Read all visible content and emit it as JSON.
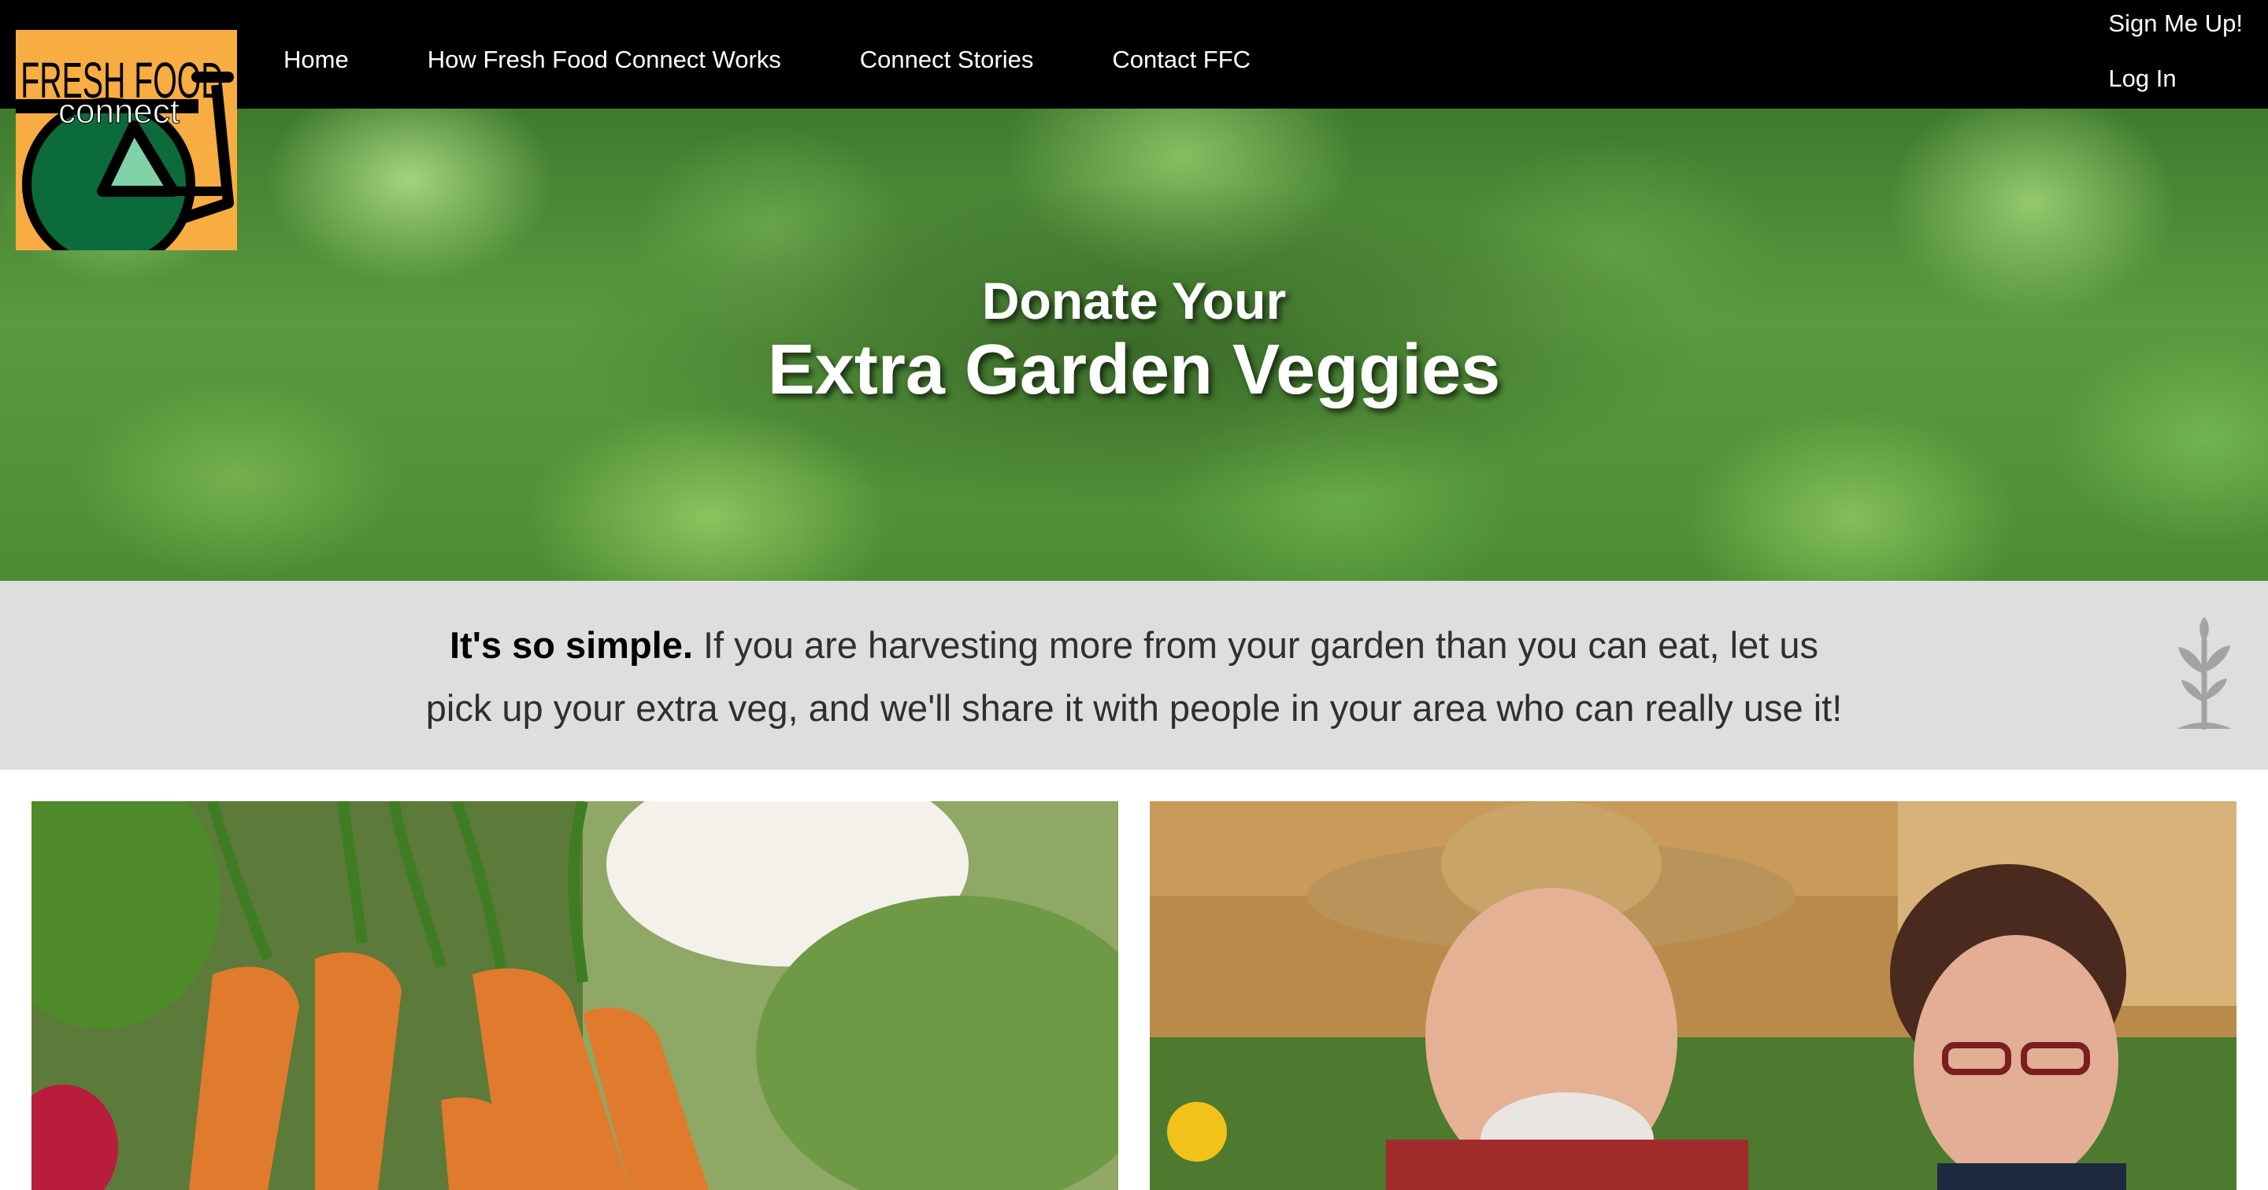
{
  "header": {
    "logo": {
      "line1": "FRESH FOOD",
      "line2": "connect",
      "colors": {
        "background": "#f7ad42",
        "wheel": "#0c6b3b",
        "wheel_inner": "#7fd3a6",
        "frame": "#000000"
      }
    },
    "nav": [
      {
        "label": "Home"
      },
      {
        "label": "How Fresh Food Connect Works"
      },
      {
        "label": "Connect Stories"
      },
      {
        "label": "Contact FFC"
      }
    ],
    "account": {
      "signup_label": "Sign Me Up!",
      "login_label": "Log In"
    },
    "colors": {
      "bar": "#000000",
      "text": "#ffffff"
    }
  },
  "hero": {
    "line1": "Donate Your",
    "line2": "Extra Garden Veggies"
  },
  "intro": {
    "lead": "It's so simple.",
    "line1_rest": " If you are harvesting more from your garden than you can eat, let us",
    "line2": "pick up your extra veg, and we'll share it with people in your area who can really use it!",
    "icon": "sprout-icon"
  },
  "photos": [
    {
      "subject": "carrots-and-vegetables-photo"
    },
    {
      "subject": "gardeners-smiling-photo"
    }
  ]
}
